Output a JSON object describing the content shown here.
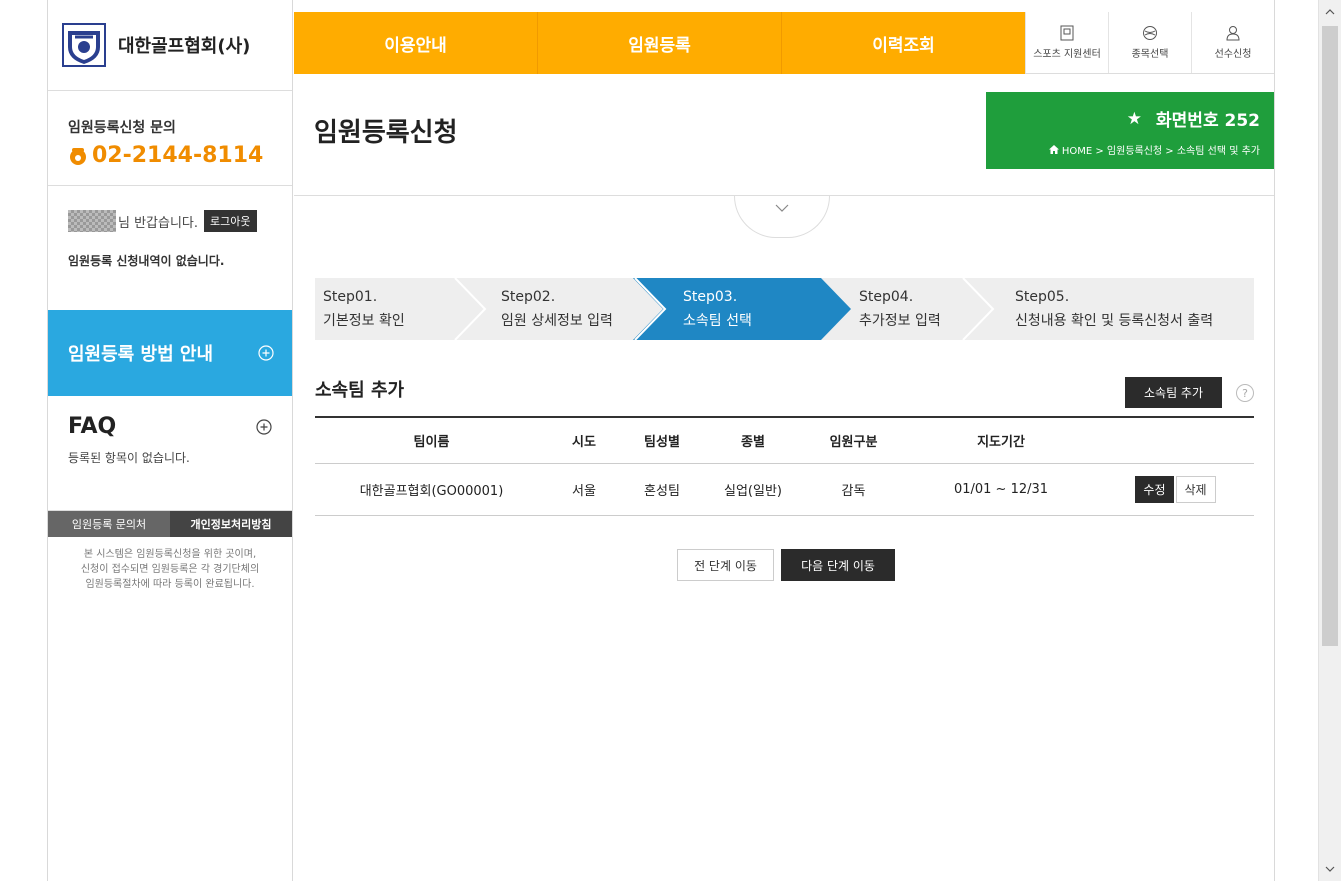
{
  "sidebar": {
    "org_name": "대한골프협회(사)",
    "contact_label": "임원등록신청 문의",
    "contact_phone": "02-2144-8114",
    "greeting": "님 반갑습니다.",
    "logout_label": "로그아웃",
    "no_history": "임원등록 신청내역이 없습니다.",
    "guide_title": "임원등록 방법 안내",
    "faq_title": "FAQ",
    "faq_empty": "등록된 항목이 없습니다.",
    "tab_contact": "임원등록 문의처",
    "tab_privacy": "개인정보처리방침",
    "notice_line1": "본 시스템은 임원등록신청을 위한 곳이며,",
    "notice_line2": "신청이 접수되면 임원등록은 각 경기단체의",
    "notice_line3": "임원등록절차에 따라 등록이 완료됩니다."
  },
  "nav": {
    "items": [
      "이용안내",
      "임원등록",
      "이력조회"
    ],
    "utility": [
      "스포츠 지원센터",
      "종목선택",
      "선수신청"
    ]
  },
  "header": {
    "page_title": "임원등록신청",
    "screen_number": "화면번호 252",
    "breadcrumb": "HOME > 임원등록신청 > 소속팀 선택 및 추가"
  },
  "steps": [
    {
      "num": "Step01.",
      "label": "기본정보 확인"
    },
    {
      "num": "Step02.",
      "label": "임원 상세정보 입력"
    },
    {
      "num": "Step03.",
      "label": "소속팀 선택"
    },
    {
      "num": "Step04.",
      "label": "추가정보 입력"
    },
    {
      "num": "Step05.",
      "label": "신청내용 확인 및 등록신청서 출력"
    }
  ],
  "section": {
    "title": "소속팀 추가",
    "add_button": "소속팀 추가",
    "help": "?"
  },
  "table": {
    "headers": [
      "팀이름",
      "시도",
      "팀성별",
      "종별",
      "임원구분",
      "지도기간",
      ""
    ],
    "rows": [
      [
        "대한골프협회(GO00001)",
        "서울",
        "혼성팀",
        "실업(일반)",
        "감독",
        "01/01 ~ 12/31"
      ]
    ],
    "edit_label": "수정",
    "delete_label": "삭제"
  },
  "actions": {
    "prev": "전 단계 이동",
    "next": "다음 단계 이동"
  },
  "colors": {
    "nav": "#ffac00",
    "guide": "#2aa8e0",
    "screen_box": "#1f9e3c",
    "step_active": "#1f87c4",
    "phone": "#f08c00"
  }
}
